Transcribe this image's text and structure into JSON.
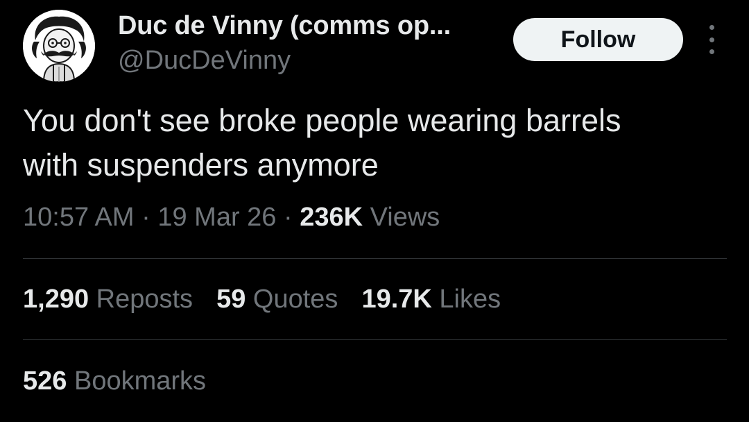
{
  "author": {
    "display_name": "Duc de Vinny (comms op...",
    "handle": "@DucDeVinny",
    "avatar_icon": "cartoon-mustache-man-avatar"
  },
  "actions": {
    "follow_label": "Follow",
    "more_icon": "more-vertical-icon"
  },
  "tweet": {
    "text_line1": "You don't see broke people wearing barrels",
    "text_line2": "with suspenders anymore"
  },
  "meta": {
    "time": "10:57 AM",
    "separator": "·",
    "date": "19 Mar 26",
    "views_count": "236K",
    "views_label": "Views"
  },
  "stats": {
    "reposts_count": "1,290",
    "reposts_label": "Reposts",
    "quotes_count": "59",
    "quotes_label": "Quotes",
    "likes_count": "19.7K",
    "likes_label": "Likes",
    "bookmarks_count": "526",
    "bookmarks_label": "Bookmarks"
  },
  "colors": {
    "background": "#000000",
    "primary_text": "#e7e9ea",
    "secondary_text": "#71767b",
    "divider": "#2f3336",
    "follow_bg": "#eff3f4"
  }
}
